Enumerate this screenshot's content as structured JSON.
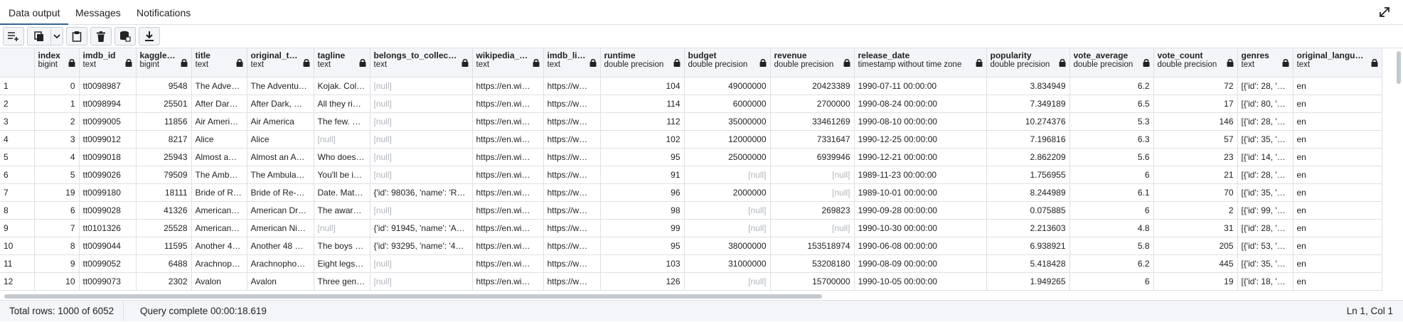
{
  "tabs": [
    {
      "label": "Data output",
      "active": true
    },
    {
      "label": "Messages",
      "active": false
    },
    {
      "label": "Notifications",
      "active": false
    }
  ],
  "toolbar": {
    "buttons": [
      "add-row-icon",
      "copy-icon",
      "chevron-down-icon",
      "paste-icon",
      "delete-icon",
      "save-data-icon",
      "download-icon"
    ]
  },
  "columns": [
    {
      "name": "index",
      "type": "bigint",
      "align": "right"
    },
    {
      "name": "imdb_id",
      "type": "text",
      "align": "left"
    },
    {
      "name": "kaggle_id",
      "type": "bigint",
      "align": "right"
    },
    {
      "name": "title",
      "type": "text",
      "align": "left"
    },
    {
      "name": "original_title",
      "type": "text",
      "align": "left"
    },
    {
      "name": "tagline",
      "type": "text",
      "align": "left"
    },
    {
      "name": "belongs_to_collection",
      "type": "text",
      "align": "left"
    },
    {
      "name": "wikipedia_url",
      "type": "text",
      "align": "left"
    },
    {
      "name": "imdb_link",
      "type": "text",
      "align": "left"
    },
    {
      "name": "runtime",
      "type": "double precision",
      "align": "right"
    },
    {
      "name": "budget",
      "type": "double precision",
      "align": "right"
    },
    {
      "name": "revenue",
      "type": "double precision",
      "align": "right"
    },
    {
      "name": "release_date",
      "type": "timestamp without time zone",
      "align": "left"
    },
    {
      "name": "popularity",
      "type": "double precision",
      "align": "right"
    },
    {
      "name": "vote_average",
      "type": "double precision",
      "align": "right"
    },
    {
      "name": "vote_count",
      "type": "double precision",
      "align": "right"
    },
    {
      "name": "genres",
      "type": "text",
      "align": "left"
    },
    {
      "name": "original_language",
      "type": "text",
      "align": "left"
    }
  ],
  "rows": [
    [
      "1",
      "0",
      "tt0098987",
      "9548",
      "The Adve…",
      "The Adventu…",
      "Kojak. Col…",
      "[null]",
      "https://en.wi…",
      "https://w…",
      "104",
      "49000000",
      "20423389",
      "1990-07-11 00:00:00",
      "3.834949",
      "6.2",
      "72",
      "[{'id': 28, '…",
      "en"
    ],
    [
      "2",
      "1",
      "tt0098994",
      "25501",
      "After Dar…",
      "After Dark, …",
      "All they ri…",
      "[null]",
      "https://en.wi…",
      "https://w…",
      "114",
      "6000000",
      "2700000",
      "1990-08-24 00:00:00",
      "7.349189",
      "6.5",
      "17",
      "[{'id': 80, '…",
      "en"
    ],
    [
      "3",
      "2",
      "tt0099005",
      "11856",
      "Air Ameri…",
      "Air America",
      "The few. …",
      "[null]",
      "https://en.wi…",
      "https://w…",
      "112",
      "35000000",
      "33461269",
      "1990-08-10 00:00:00",
      "10.274376",
      "5.3",
      "146",
      "[{'id': 28, '…",
      "en"
    ],
    [
      "4",
      "3",
      "tt0099012",
      "8217",
      "Alice",
      "Alice",
      "[null]",
      "[null]",
      "https://en.wi…",
      "https://w…",
      "102",
      "12000000",
      "7331647",
      "1990-12-25 00:00:00",
      "7.196816",
      "6.3",
      "57",
      "[{'id': 35, '…",
      "en"
    ],
    [
      "5",
      "4",
      "tt0099018",
      "25943",
      "Almost a…",
      "Almost an A…",
      "Who does…",
      "[null]",
      "https://en.wi…",
      "https://w…",
      "95",
      "25000000",
      "6939946",
      "1990-12-21 00:00:00",
      "2.862209",
      "5.6",
      "23",
      "[{'id': 14, '…",
      "en"
    ],
    [
      "6",
      "5",
      "tt0099026",
      "79509",
      "The Amb…",
      "The Ambula…",
      "You'll be i…",
      "[null]",
      "https://en.wi…",
      "https://w…",
      "91",
      "[null]",
      "[null]",
      "1989-11-23 00:00:00",
      "1.756955",
      "6",
      "21",
      "[{'id': 28, '…",
      "en"
    ],
    [
      "7",
      "19",
      "tt0099180",
      "18111",
      "Bride of R…",
      "Bride of Re-…",
      "Date. Mat…",
      "{'id': 98036, 'name': 'R…",
      "https://en.wi…",
      "https://w…",
      "96",
      "2000000",
      "[null]",
      "1989-10-01 00:00:00",
      "8.244989",
      "6.1",
      "70",
      "[{'id': 35, '…",
      "en"
    ],
    [
      "8",
      "6",
      "tt0099028",
      "41326",
      "American…",
      "American Dr…",
      "The awar…",
      "[null]",
      "https://en.wi…",
      "https://w…",
      "98",
      "[null]",
      "269823",
      "1990-09-28 00:00:00",
      "0.075885",
      "6",
      "2",
      "[{'id': 99, '…",
      "en"
    ],
    [
      "9",
      "7",
      "tt0101326",
      "25528",
      "American…",
      "American Ni…",
      "[null]",
      "{'id': 91945, 'name': 'A…",
      "https://en.wi…",
      "https://w…",
      "99",
      "[null]",
      "[null]",
      "1990-10-30 00:00:00",
      "2.213603",
      "4.8",
      "31",
      "[{'id': 28, '…",
      "en"
    ],
    [
      "10",
      "8",
      "tt0099044",
      "11595",
      "Another 4…",
      "Another 48 …",
      "The boys …",
      "{'id': 93295, 'name': '4…",
      "https://en.wi…",
      "https://w…",
      "95",
      "38000000",
      "153518974",
      "1990-06-08 00:00:00",
      "6.938921",
      "5.8",
      "205",
      "[{'id': 53, '…",
      "en"
    ],
    [
      "11",
      "9",
      "tt0099052",
      "6488",
      "Arachnop…",
      "Arachnopho…",
      "Eight legs…",
      "[null]",
      "https://en.wi…",
      "https://w…",
      "103",
      "31000000",
      "53208180",
      "1990-08-09 00:00:00",
      "5.418428",
      "6.2",
      "445",
      "[{'id': 35, '…",
      "en"
    ],
    [
      "12",
      "10",
      "tt0099073",
      "2302",
      "Avalon",
      "Avalon",
      "Three gen…",
      "[null]",
      "https://en.wi…",
      "https://w…",
      "126",
      "[null]",
      "15700000",
      "1990-10-05 00:00:00",
      "1.949265",
      "6",
      "19",
      "[{'id': 18, '…",
      "en"
    ]
  ],
  "status": {
    "total_rows": "Total rows: 1000 of 6052",
    "query": "Query complete 00:00:18.619",
    "cursor": "Ln 1, Col 1"
  }
}
